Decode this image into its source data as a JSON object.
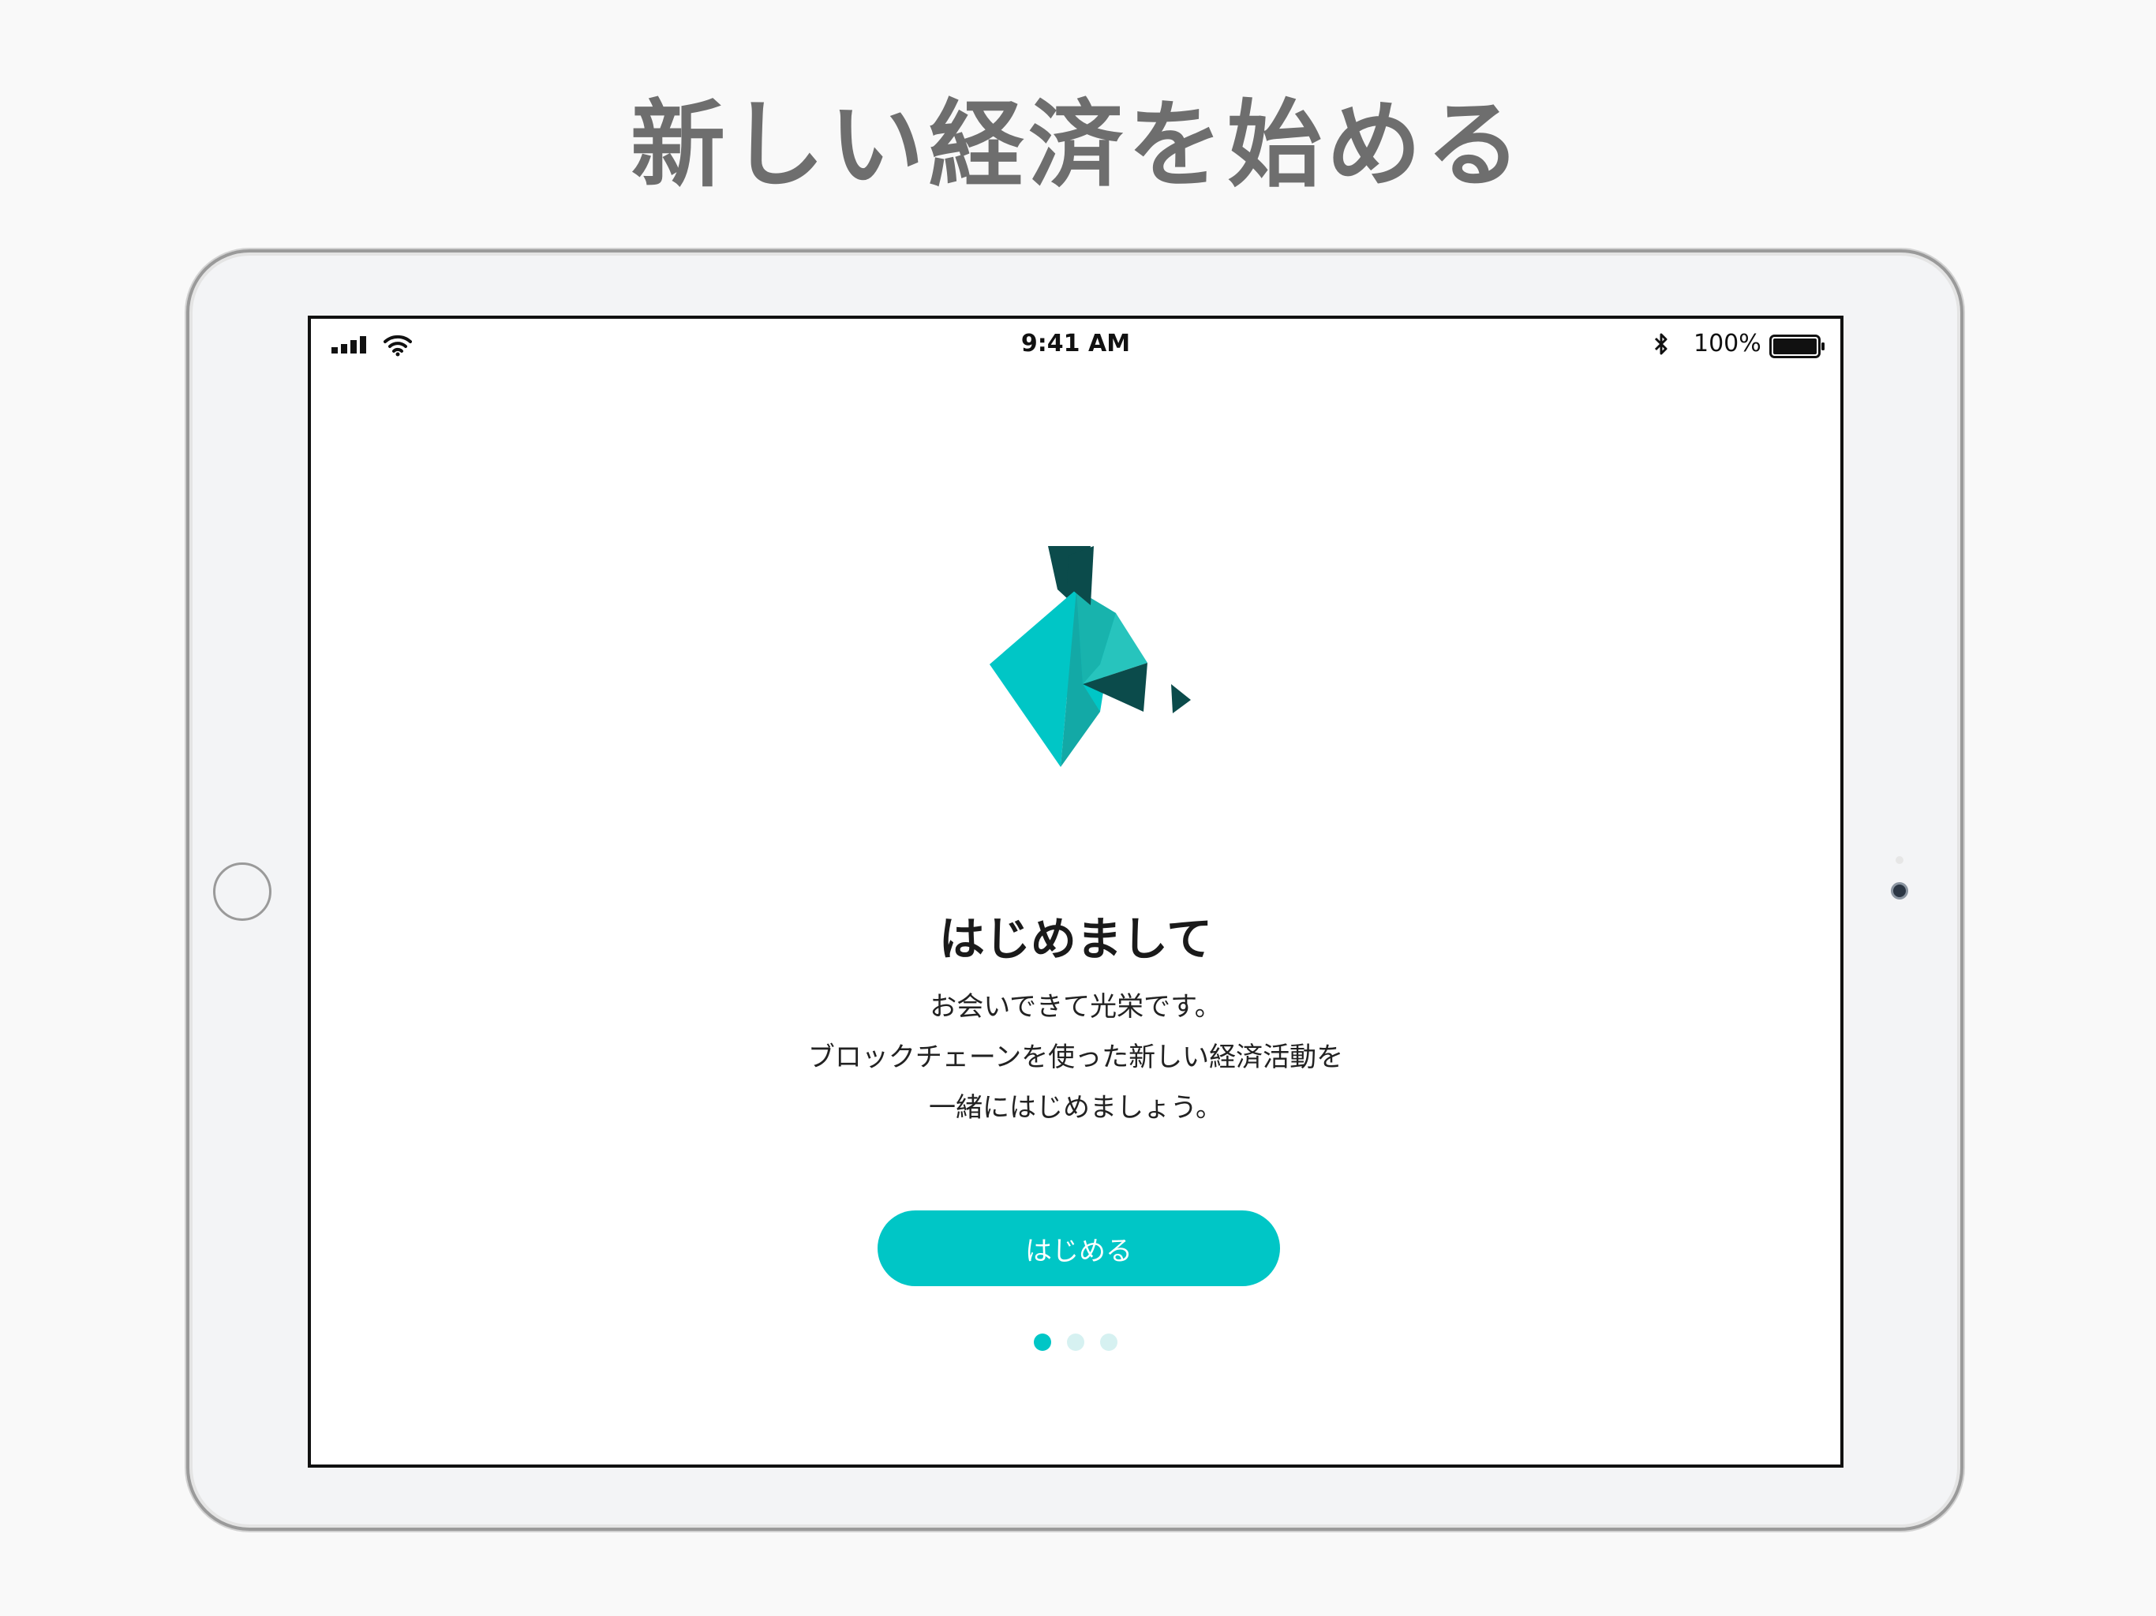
{
  "headline": "新しい経済を始める",
  "status_bar": {
    "time": "9:41 AM",
    "battery_percent": "100%",
    "icons": [
      "cellular-signal-icon",
      "wifi-icon",
      "bluetooth-icon",
      "battery-icon"
    ]
  },
  "onboarding": {
    "title": "はじめまして",
    "description_lines": [
      "お会いできて光栄です。",
      "ブロックチェーンを使った新しい経済活動を",
      "一緒にはじめましょう。"
    ],
    "start_button_label": "はじめる",
    "page_indicator": {
      "total": 3,
      "current": 1
    }
  },
  "colors": {
    "accent": "#00c6c6",
    "accent_light": "#d6f1f1",
    "logo_dark": "#0b4b4b",
    "logo_mid": "#18b3ad",
    "headline_gray": "#6e6e6e"
  }
}
